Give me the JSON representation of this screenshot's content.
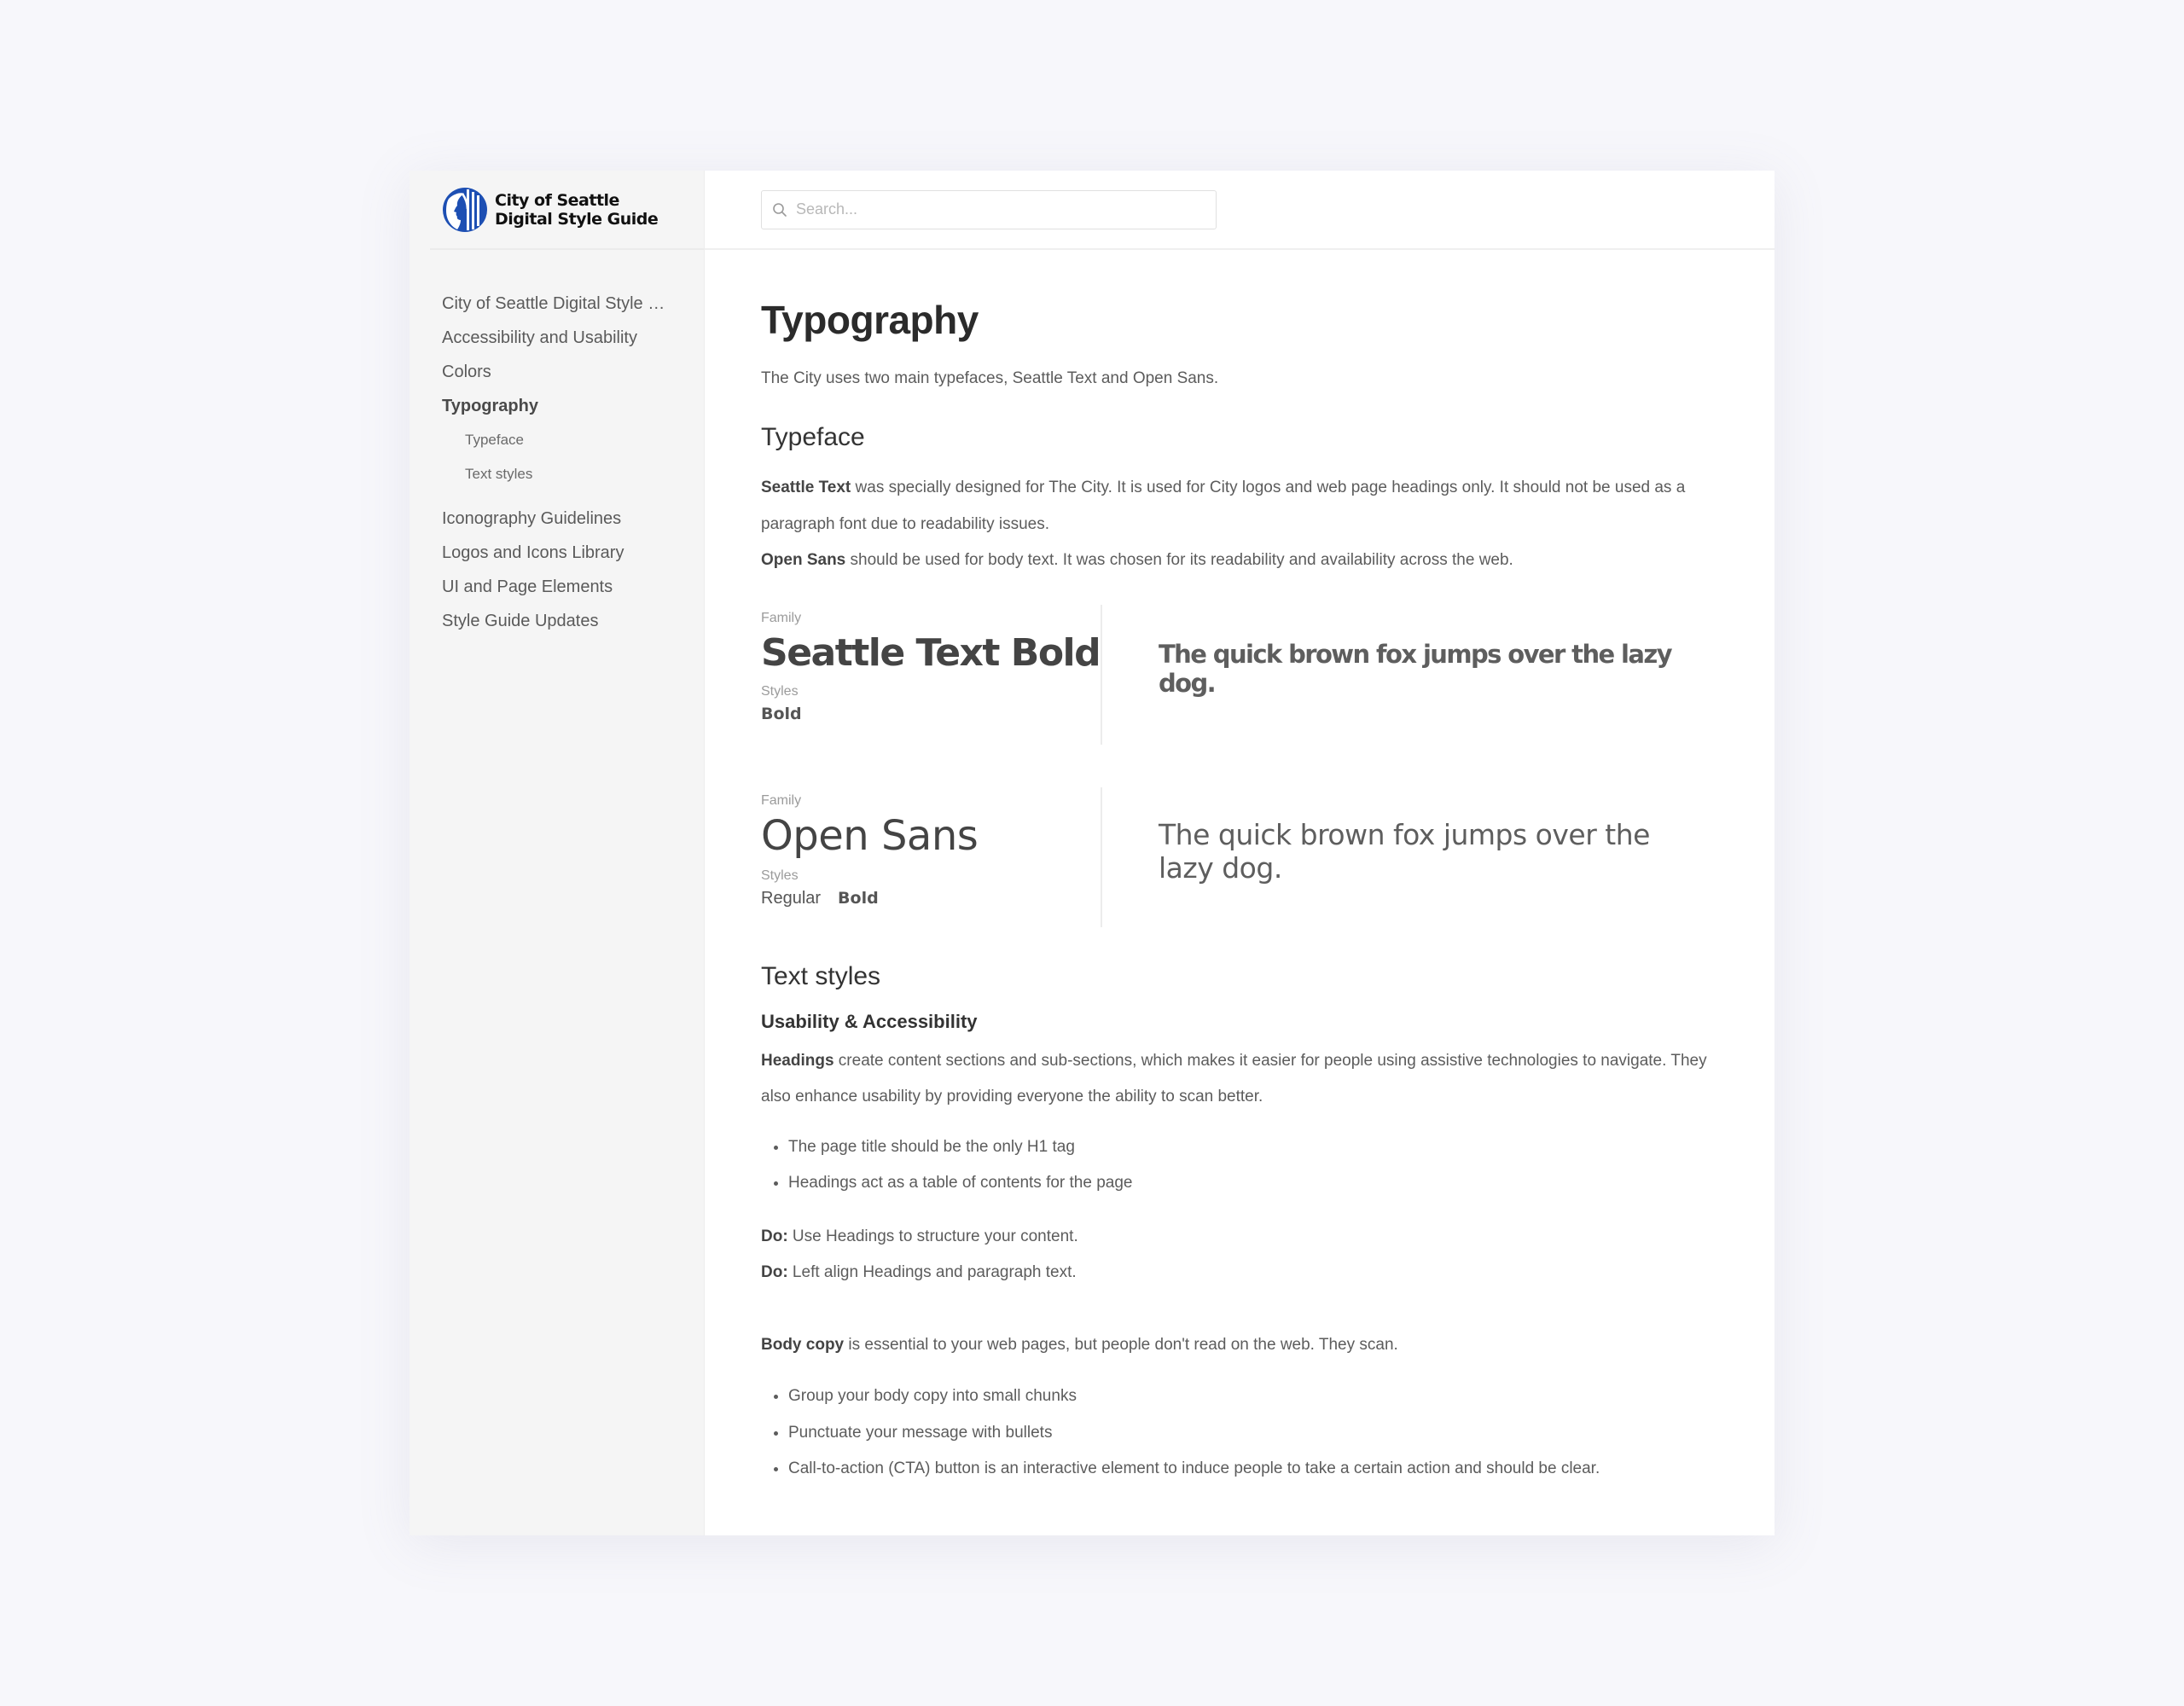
{
  "app": {
    "logo_line1": "City of Seattle",
    "logo_line2": "Digital Style Guide",
    "brand_color": "#1d4fb3"
  },
  "search": {
    "placeholder": "Search...",
    "value": ""
  },
  "sidebar": {
    "items": [
      {
        "label": "City of Seattle Digital Style Guide",
        "active": false
      },
      {
        "label": "Accessibility and Usability",
        "active": false
      },
      {
        "label": "Colors",
        "active": false
      },
      {
        "label": "Typography",
        "active": true
      },
      {
        "label": "Iconography Guidelines",
        "active": false
      },
      {
        "label": "Logos and Icons Library",
        "active": false
      },
      {
        "label": "UI and Page Elements",
        "active": false
      },
      {
        "label": "Style Guide Updates",
        "active": false
      }
    ],
    "subitems": [
      {
        "label": "Typeface"
      },
      {
        "label": "Text styles"
      }
    ]
  },
  "page": {
    "title": "Typography",
    "intro": "The City uses two main typefaces, Seattle Text and Open Sans.",
    "typeface": {
      "heading": "Typeface",
      "p1_bold": "Seattle Text",
      "p1_rest": " was specially designed for The City. It is used for City logos and web page headings only. It should not be used as a paragraph font due to readability issues.",
      "p2_bold": "Open Sans",
      "p2_rest": " should be used for body text. It was chosen for its readability and availability across the web."
    },
    "families": [
      {
        "family_label": "Family",
        "name": "Seattle Text Bold",
        "styles_label": "Styles",
        "styles": [
          "Bold"
        ],
        "sample": "The quick brown fox jumps over the lazy dog."
      },
      {
        "family_label": "Family",
        "name": "Open Sans",
        "styles_label": "Styles",
        "styles": [
          "Regular",
          "Bold"
        ],
        "sample": "The quick brown fox jumps over the lazy dog."
      }
    ],
    "text_styles": {
      "heading": "Text styles",
      "subheading": "Usability & Accessibility",
      "headings_bold": "Headings",
      "headings_rest": " create content sections and sub-sections, which makes it easier for people using assistive technologies to navigate. They also enhance usability by providing everyone the ability to scan better.",
      "bullets1": [
        "The page title should be the only H1 tag",
        "Headings act as a table of contents for the page"
      ],
      "do_label": "Do:",
      "do1": " Use Headings to structure your content.",
      "do2": " Left align Headings and paragraph text.",
      "body_bold": "Body copy",
      "body_rest": " is essential to your web pages, but people don't read on the web. They scan.",
      "bullets2": [
        "Group your body copy into small chunks",
        "Punctuate your message with bullets",
        "Call-to-action (CTA) button is an interactive element to induce people to take a certain action and should be clear."
      ]
    }
  }
}
